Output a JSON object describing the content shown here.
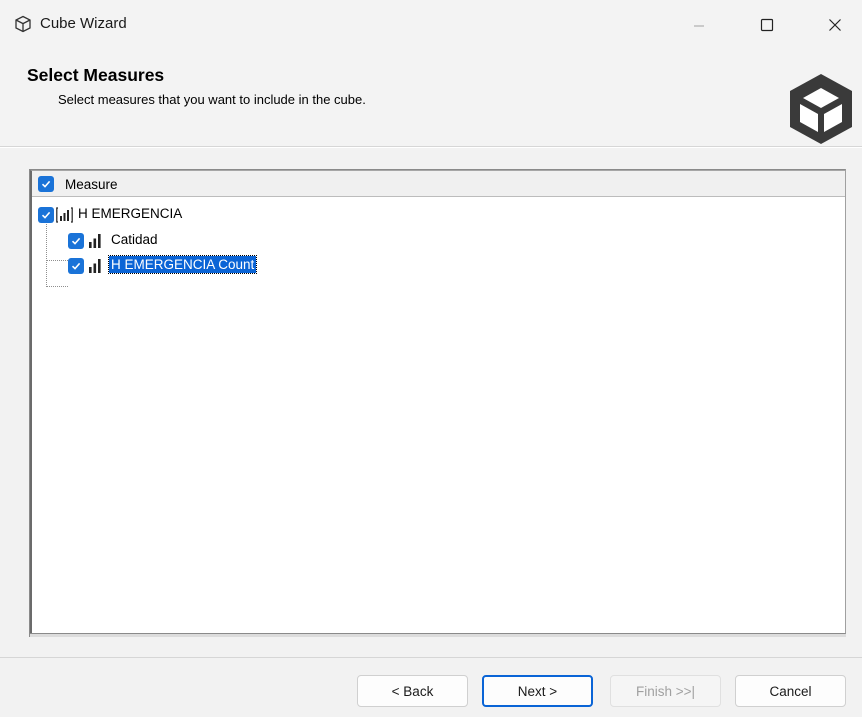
{
  "window": {
    "title": "Cube Wizard",
    "icon": "cube-icon",
    "controls": [
      "minimize-icon",
      "maximize-icon",
      "close-icon"
    ]
  },
  "header": {
    "title": "Select Measures",
    "description": "Select measures that you want to include in the cube.",
    "logo_icon": "cube-logo-icon"
  },
  "tree": {
    "column_header": "Measure",
    "column_checked": true,
    "nodes": [
      {
        "label": "H EMERGENCIA",
        "checked": true,
        "icon": "measure-group-icon",
        "children": [
          {
            "label": "Catidad",
            "checked": true,
            "icon": "measure-icon",
            "selected": false
          },
          {
            "label": "H EMERGENCIA Count",
            "checked": true,
            "icon": "measure-icon",
            "selected": true
          }
        ]
      }
    ]
  },
  "buttons": {
    "back": "< Back",
    "next": "Next >",
    "finish": "Finish >>|",
    "cancel": "Cancel",
    "finish_enabled": false,
    "default_button": "next"
  },
  "colors": {
    "accent": "#0a64d6",
    "checkbox": "#1a73d8",
    "chrome_bg": "#f3f3f3"
  }
}
